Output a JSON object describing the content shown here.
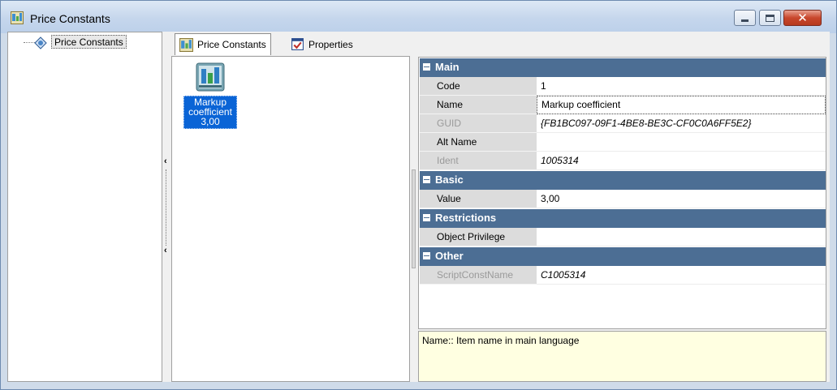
{
  "window": {
    "title": "Price Constants",
    "icon": "price-constants-icon"
  },
  "tree": {
    "root_label": "Price Constants"
  },
  "tabs": [
    {
      "label": "Price Constants",
      "icon": "price-constants-icon",
      "active": true
    },
    {
      "label": "Properties",
      "icon": "properties-icon",
      "active": false
    }
  ],
  "list": {
    "items": [
      {
        "caption_line1": "Markup",
        "caption_line2": "coefficient",
        "caption_line3": "3,00",
        "icon": "price-constant-icon",
        "selected": true
      }
    ]
  },
  "properties": {
    "categories": [
      {
        "label": "Main",
        "rows": [
          {
            "name": "Code",
            "value": "1"
          },
          {
            "name": "Name",
            "value": "Markup coefficient"
          },
          {
            "name": "GUID",
            "value": "{FB1BC097-09F1-4BE8-BE3C-CF0C0A6FF5E2}"
          },
          {
            "name": "Alt Name",
            "value": ""
          },
          {
            "name": "Ident",
            "value": "1005314"
          }
        ]
      },
      {
        "label": "Basic",
        "rows": [
          {
            "name": "Value",
            "value": "3,00"
          }
        ]
      },
      {
        "label": "Restrictions",
        "rows": [
          {
            "name": "Object Privilege",
            "value": ""
          }
        ]
      },
      {
        "label": "Other",
        "rows": [
          {
            "name": "ScriptConstName",
            "value": "C1005314"
          }
        ]
      }
    ]
  },
  "help": {
    "text": "Name:: Item name in main language"
  },
  "colors": {
    "category_header": "#4c6e94",
    "selection": "#0a64d6",
    "help_background": "#ffffe1"
  }
}
